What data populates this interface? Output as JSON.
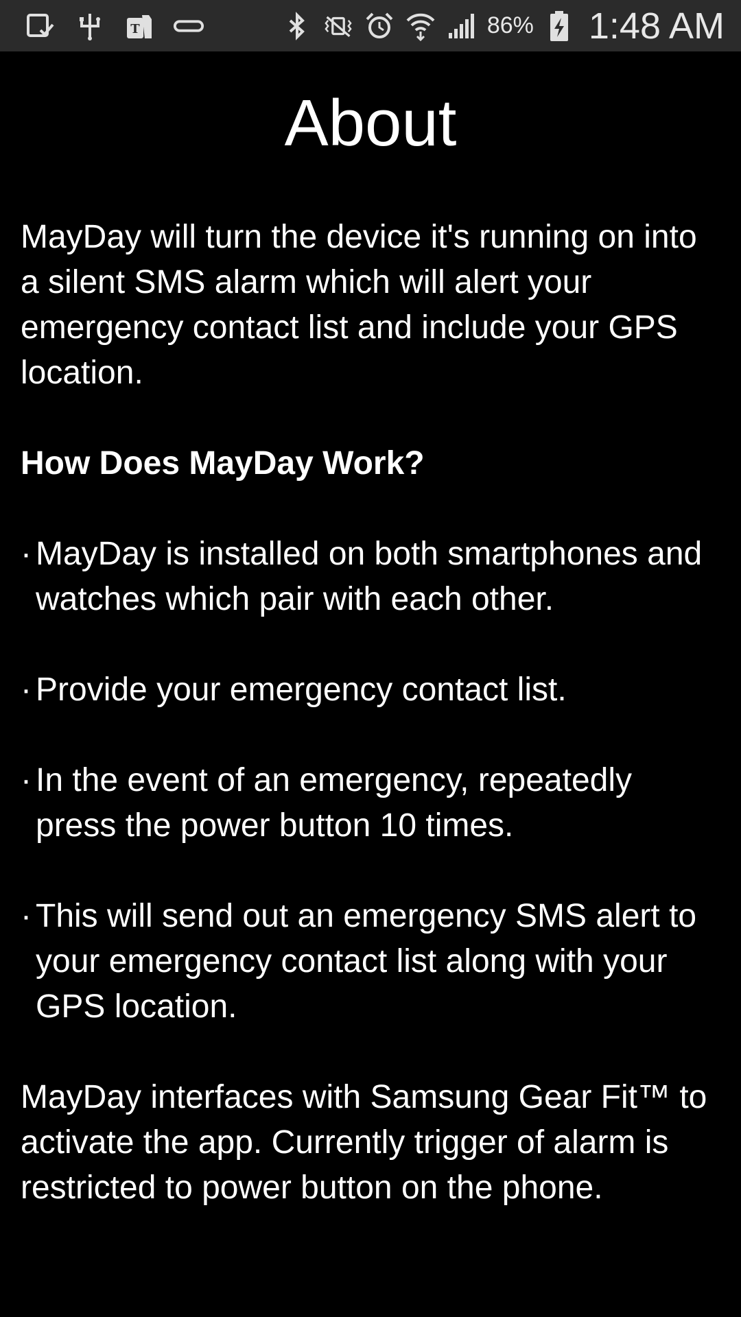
{
  "status_bar": {
    "left_icons": [
      "screenshot-icon",
      "usb-icon",
      "tmobile-icon",
      "gear-fit-icon"
    ],
    "right_icons": [
      "bluetooth-icon",
      "vibrate-icon",
      "alarm-icon",
      "wifi-icon",
      "signal-icon",
      "battery-charging-icon"
    ],
    "battery_percent": "86%",
    "time": "1:48 AM"
  },
  "about": {
    "title": "About",
    "intro": "MayDay will turn the device it's running on into a silent SMS alarm which will alert your emergency contact list and include your GPS location.",
    "how_heading": "How Does MayDay Work?",
    "bullet_symbol": "·",
    "bullets": [
      "MayDay is installed on both smartphones and watches which pair with each other.",
      "Provide your emergency contact list.",
      "In the event of an emergency, repeatedly press the power button 10 times.",
      "This will send out an emergency SMS alert to your emergency contact list along with your GPS location."
    ],
    "outro": "MayDay interfaces with Samsung Gear Fit™ to activate the app. Currently trigger of alarm is restricted to power button on the phone."
  },
  "colors": {
    "background": "#000000",
    "status_bar": "#2b2b2b",
    "text": "#ffffff"
  }
}
